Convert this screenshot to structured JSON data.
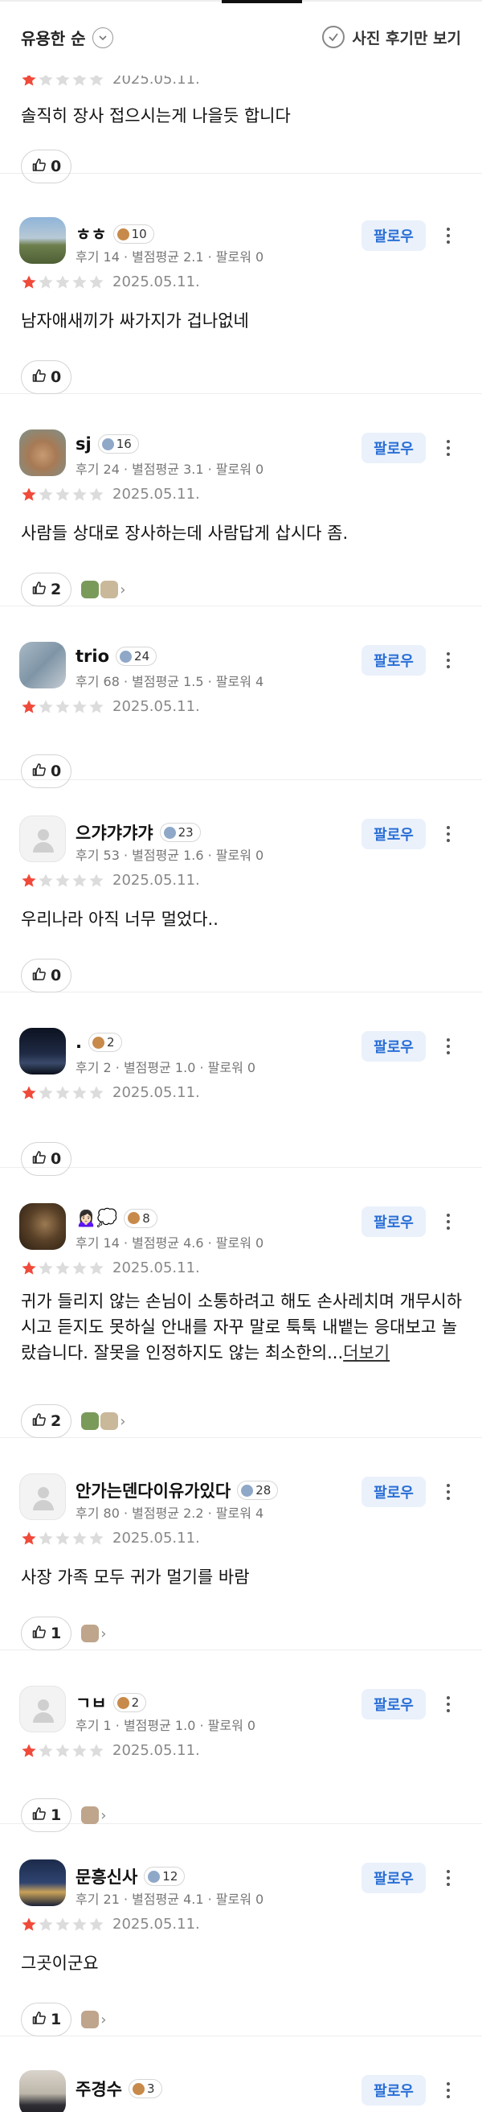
{
  "header": {
    "sort_label": "유용한 순",
    "photo_only_label": "사진 후기만 보기"
  },
  "follow_label": "팔로우",
  "reviews": [
    {
      "name": "",
      "badge": "",
      "badge_type": "",
      "stats": "",
      "rating": 1,
      "date": "2025.05.11.",
      "content": "솔직히 장사 접으시는게 나을듯 합니다",
      "likes": "0",
      "photos": 0,
      "avatar": "partial"
    },
    {
      "name": "ㅎㅎ",
      "badge": "10",
      "badge_type": "brown",
      "stats": "후기 14 · 별점평균 2.1 · 팔로워 0",
      "rating": 1,
      "date": "2025.05.11.",
      "content": "남자애새끼가 싸가지가 겁나없네",
      "likes": "0",
      "photos": 0,
      "avatar": "landscape"
    },
    {
      "name": "sj",
      "badge": "16",
      "badge_type": "blue",
      "stats": "후기 24 · 별점평균 3.1 · 팔로워 0",
      "rating": 1,
      "date": "2025.05.11.",
      "content": "사람들 상대로 장사하는데 사람답게 삽시다 좀.",
      "likes": "2",
      "photos": 2,
      "avatar": "cat"
    },
    {
      "name": "trio",
      "badge": "24",
      "badge_type": "blue",
      "stats": "후기 68 · 별점평균 1.5 · 팔로워 4",
      "rating": 1,
      "date": "2025.05.11.",
      "content": "",
      "likes": "0",
      "photos": 0,
      "avatar": "blue"
    },
    {
      "name": "으갸갸갸갸",
      "badge": "23",
      "badge_type": "blue",
      "stats": "후기 53 · 별점평균 1.6 · 팔로워 0",
      "rating": 1,
      "date": "2025.05.11.",
      "content": "우리나라 아직 너무 멀었다..",
      "likes": "0",
      "photos": 0,
      "avatar": "default"
    },
    {
      "name": ".",
      "badge": "2",
      "badge_type": "brown",
      "stats": "후기 2 · 별점평균 1.0 · 팔로워 0",
      "rating": 1,
      "date": "2025.05.11.",
      "content": "",
      "likes": "0",
      "photos": 0,
      "avatar": "night"
    },
    {
      "name": "🙍🏻‍♀️💭",
      "badge": "8",
      "badge_type": "brown",
      "stats": "후기 14 · 별점평균 4.6 · 팔로워 0",
      "rating": 1,
      "date": "2025.05.11.",
      "content": "귀가 들리지 않는 손님이 소통하려고 해도 손사레치며 개무시하시고 듣지도 못하실 안내를 자꾸 말로 툭툭 내뱉는 응대보고 놀랐습니다. 잘못을 인정하지도 않는 최소한의...",
      "more_link": "더보기",
      "likes": "2",
      "photos": 2,
      "avatar": "dark"
    },
    {
      "name": "안가는덴다이유가있다",
      "badge": "28",
      "badge_type": "blue",
      "stats": "후기 80 · 별점평균 2.2 · 팔로워 4",
      "rating": 1,
      "date": "2025.05.11.",
      "content": "사장 가족 모두 귀가 멀기를 바람",
      "likes": "1",
      "photos": 1,
      "avatar": "default"
    },
    {
      "name": "ㄱㅂ",
      "badge": "2",
      "badge_type": "brown",
      "stats": "후기 1 · 별점평균 1.0 · 팔로워 0",
      "rating": 1,
      "date": "2025.05.11.",
      "content": "",
      "likes": "1",
      "photos": 1,
      "avatar": "default"
    },
    {
      "name": "문흥신사",
      "badge": "12",
      "badge_type": "blue",
      "stats": "후기 21 · 별점평균 4.1 · 팔로워 0",
      "rating": 1,
      "date": "2025.05.11.",
      "content": "그곳이군요",
      "likes": "1",
      "photos": 1,
      "avatar": "city"
    },
    {
      "name": "주경수",
      "badge": "3",
      "badge_type": "brown",
      "stats": "",
      "rating": 0,
      "date": "",
      "content": "",
      "likes": "",
      "photos": 0,
      "avatar": "person"
    }
  ]
}
